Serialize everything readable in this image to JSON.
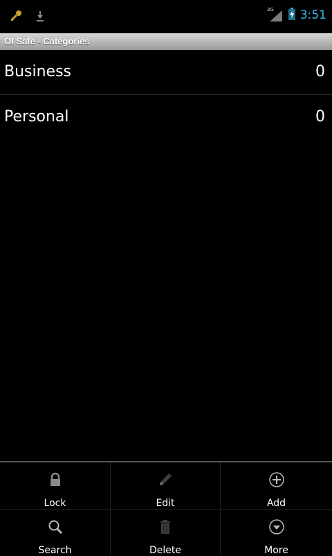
{
  "status_bar": {
    "left_icons": [
      "key-icon",
      "download-icon"
    ],
    "network_label": "3G",
    "time": "3:51",
    "accent_color": "#33b5e5"
  },
  "title_bar": {
    "title": "OI Safe - Categories"
  },
  "categories": [
    {
      "name": "Business",
      "count": "0"
    },
    {
      "name": "Personal",
      "count": "0"
    }
  ],
  "menu": {
    "items": [
      {
        "label": "Lock",
        "icon": "lock-icon"
      },
      {
        "label": "Edit",
        "icon": "pencil-icon"
      },
      {
        "label": "Add",
        "icon": "plus-circle-icon"
      },
      {
        "label": "Search",
        "icon": "search-icon"
      },
      {
        "label": "Delete",
        "icon": "trash-icon"
      },
      {
        "label": "More",
        "icon": "chevron-down-circle-icon"
      }
    ]
  }
}
